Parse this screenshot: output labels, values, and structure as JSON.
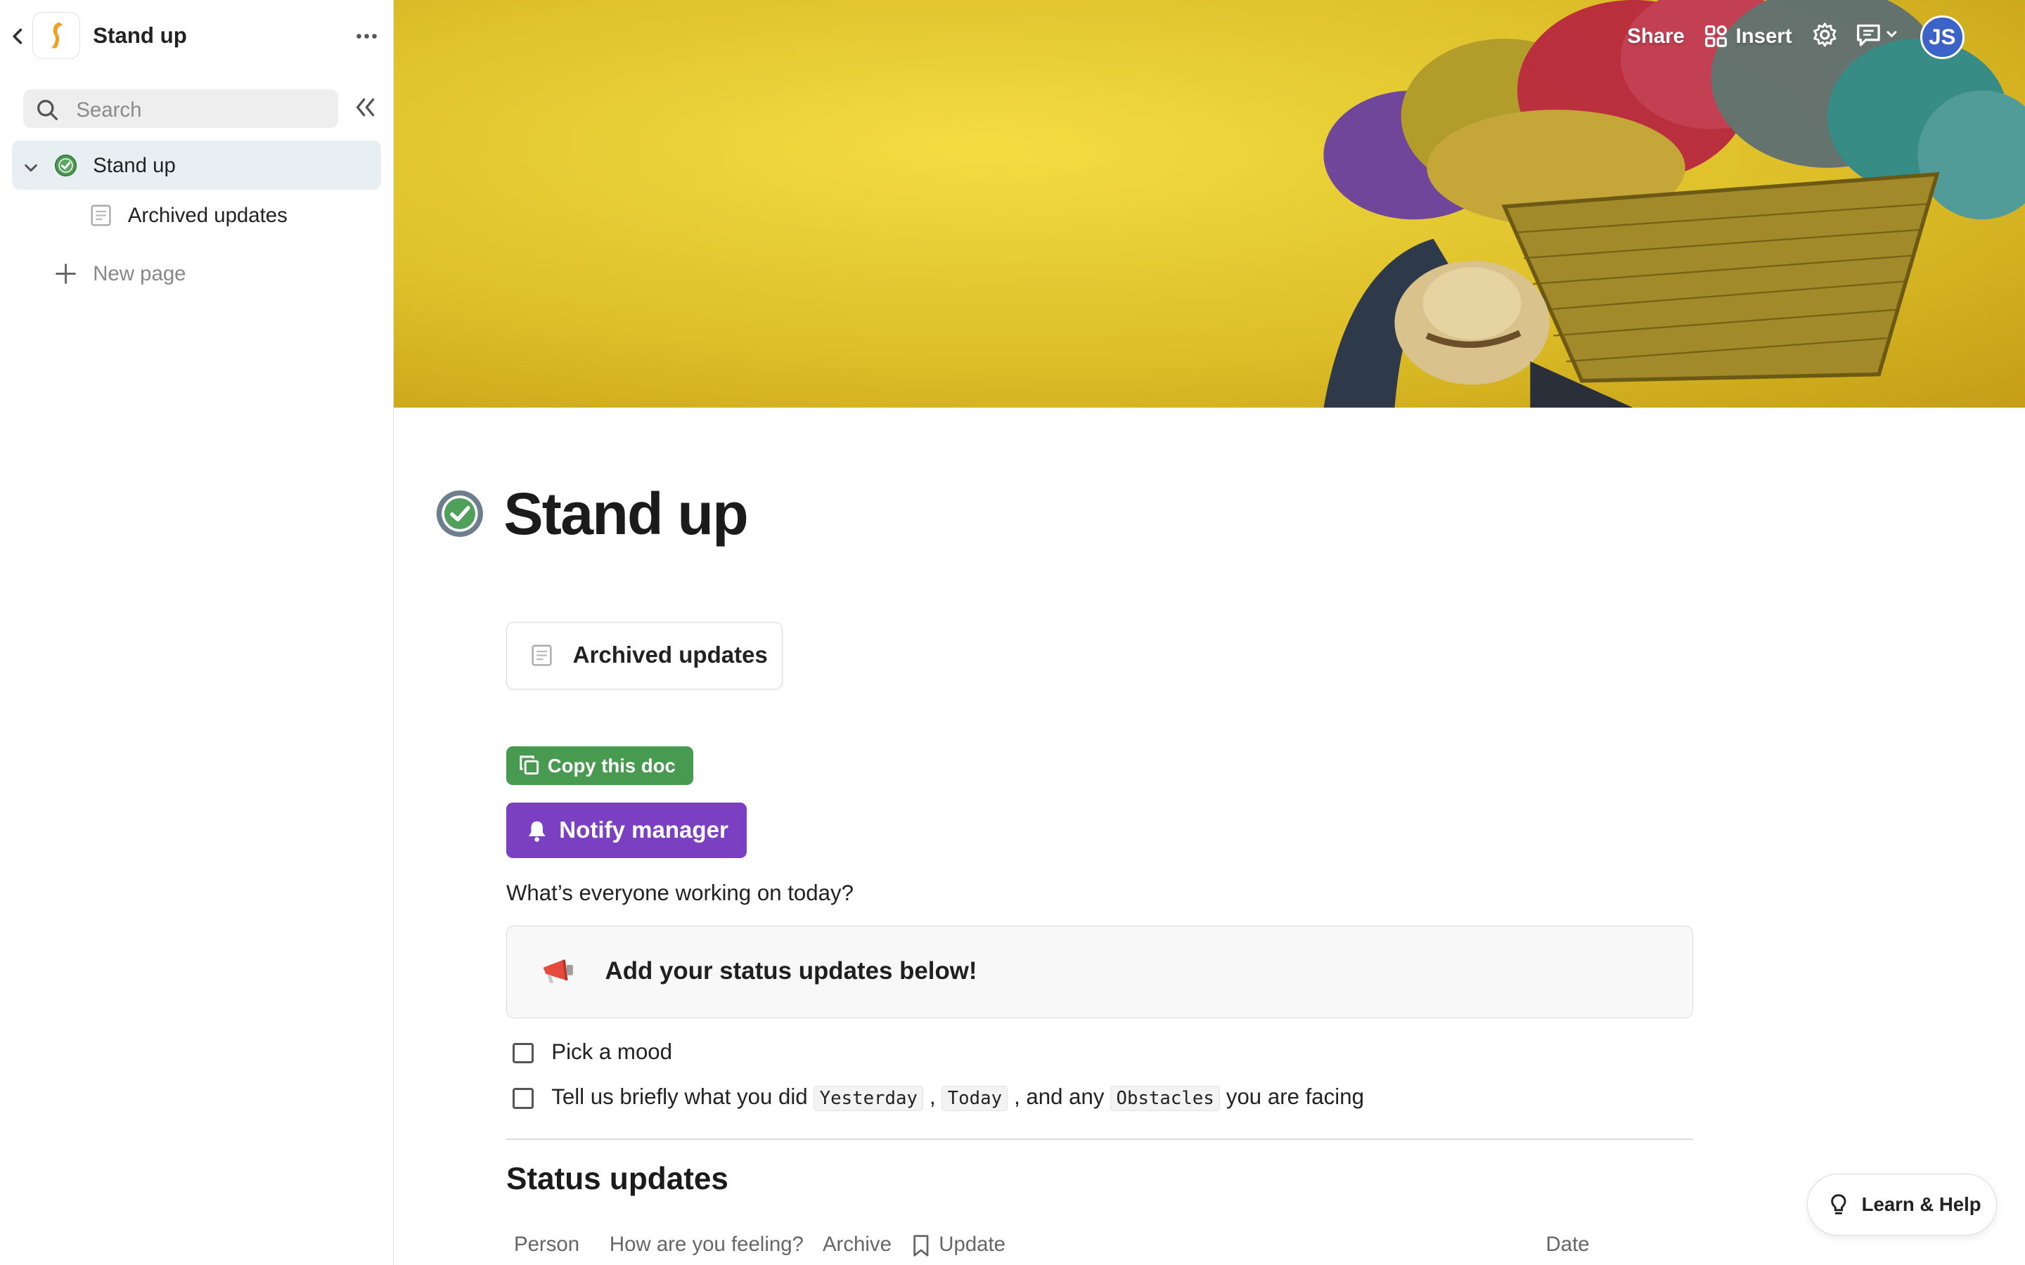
{
  "sidebar": {
    "doc_title": "Stand up",
    "search_placeholder": "Search",
    "pages": [
      {
        "label": "Stand up"
      },
      {
        "label": "Archived updates"
      }
    ],
    "new_page_label": "New page"
  },
  "topbar": {
    "share_label": "Share",
    "insert_label": "Insert",
    "avatar_initials": "JS"
  },
  "page": {
    "title": "Stand up",
    "subpage_card_label": "Archived updates",
    "copy_button_label": "Copy this doc",
    "notify_button_label": "Notify manager",
    "question": "What’s everyone working on today?",
    "callout_text": "Add your status updates below!",
    "todos": [
      {
        "text": "Pick a mood",
        "checked": false
      },
      {
        "parts": [
          "Tell us briefly what you did ",
          "Yesterday",
          " , ",
          "Today",
          " , and any ",
          "Obstacles",
          " you are facing"
        ],
        "checked": false
      }
    ],
    "section_title": "Status updates",
    "table_columns": [
      "Person",
      "How are you feeling?",
      "Archive",
      "Update",
      "Date"
    ]
  },
  "help_button_label": "Learn & Help",
  "colors": {
    "accent_green": "#479a4f",
    "accent_purple": "#7b3fc1",
    "avatar_blue": "#3c63c8",
    "cover_yellow": "#e9c92c"
  },
  "icons": [
    "chevron-left-icon",
    "doc-logo-icon",
    "more-icon",
    "search-icon",
    "collapse-sidebar-icon",
    "chevron-down-icon",
    "check-circle-icon",
    "page-icon",
    "plus-icon",
    "insert-grid-icon",
    "gear-icon",
    "comment-icon",
    "copy-icon",
    "bell-icon",
    "megaphone-icon",
    "bookmark-icon",
    "lightbulb-icon"
  ]
}
